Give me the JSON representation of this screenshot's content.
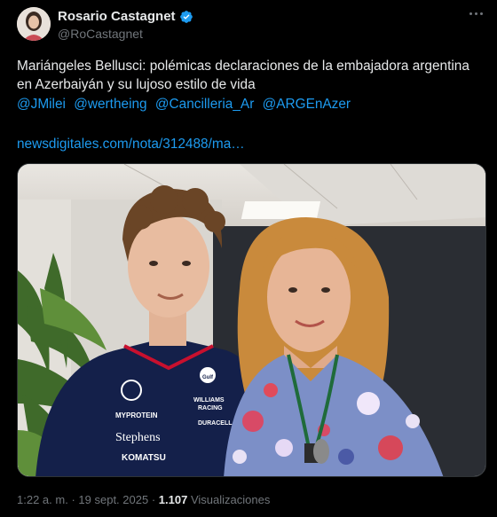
{
  "author": {
    "display_name": "Rosario Castagnet",
    "handle": "@RoCastagnet"
  },
  "tweet": {
    "text": "Mariángeles Bellusci: polémicas declaraciones de la embajadora argentina en Azerbaiyán y su lujoso estilo de vida",
    "mentions": [
      "@JMilei",
      "@wertheing",
      "@Cancilleria_Ar",
      "@ARGEnAzer"
    ],
    "link": "newsdigitales.com/nota/312488/ma…"
  },
  "media": {
    "shirt_texts": [
      "MYPROTEIN",
      "Stephens",
      "KOMATSU",
      "WILLIAMS",
      "RACING",
      "DURACELL",
      "Gulf"
    ]
  },
  "meta": {
    "time": "1:22 a. m.",
    "separator": "·",
    "date": "19 sept. 2025",
    "views_count": "1.107",
    "views_label": "Visualizaciones"
  },
  "colors": {
    "background": "#000000",
    "link": "#1d9bf0",
    "muted": "#71767b",
    "verified": "#1d9bf0"
  }
}
